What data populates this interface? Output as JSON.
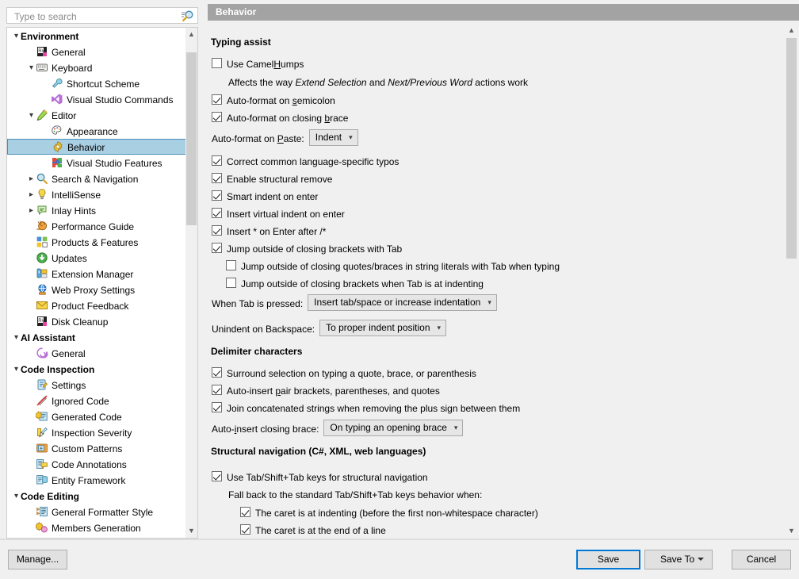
{
  "search": {
    "placeholder": "Type to search",
    "value": "",
    "icon": "search-icon"
  },
  "sidebar": {
    "items": [
      {
        "label": "Environment",
        "level": 0,
        "arrow": "expanded",
        "group": true,
        "icon": "none",
        "selected": false
      },
      {
        "label": "General",
        "level": 1,
        "arrow": "none",
        "group": false,
        "icon": "resharper-general-icon",
        "selected": false
      },
      {
        "label": "Keyboard",
        "level": 1,
        "arrow": "expanded",
        "group": false,
        "icon": "keyboard-icon",
        "selected": false
      },
      {
        "label": "Shortcut Scheme",
        "level": 2,
        "arrow": "none",
        "group": false,
        "icon": "wrench-icon",
        "selected": false
      },
      {
        "label": "Visual Studio Commands",
        "level": 2,
        "arrow": "none",
        "group": false,
        "icon": "visual-studio-icon",
        "selected": false
      },
      {
        "label": "Editor",
        "level": 1,
        "arrow": "expanded",
        "group": false,
        "icon": "pencil-icon",
        "selected": false
      },
      {
        "label": "Appearance",
        "level": 2,
        "arrow": "none",
        "group": false,
        "icon": "palette-icon",
        "selected": false
      },
      {
        "label": "Behavior",
        "level": 2,
        "arrow": "none",
        "group": false,
        "icon": "gear-icon",
        "selected": true
      },
      {
        "label": "Visual Studio Features",
        "level": 2,
        "arrow": "none",
        "group": false,
        "icon": "puzzle-icon",
        "selected": false
      },
      {
        "label": "Search & Navigation",
        "level": 1,
        "arrow": "collapsed",
        "group": false,
        "icon": "magnifier-icon",
        "selected": false
      },
      {
        "label": "IntelliSense",
        "level": 1,
        "arrow": "collapsed",
        "group": false,
        "icon": "lightbulb-icon",
        "selected": false
      },
      {
        "label": "Inlay Hints",
        "level": 1,
        "arrow": "collapsed",
        "group": false,
        "icon": "inlay-hints-icon",
        "selected": false
      },
      {
        "label": "Performance Guide",
        "level": 1,
        "arrow": "none",
        "group": false,
        "icon": "snail-icon",
        "selected": false
      },
      {
        "label": "Products & Features",
        "level": 1,
        "arrow": "none",
        "group": false,
        "icon": "products-icon",
        "selected": false
      },
      {
        "label": "Updates",
        "level": 1,
        "arrow": "none",
        "group": false,
        "icon": "updates-icon",
        "selected": false
      },
      {
        "label": "Extension Manager",
        "level": 1,
        "arrow": "none",
        "group": false,
        "icon": "extension-icon",
        "selected": false
      },
      {
        "label": "Web Proxy Settings",
        "level": 1,
        "arrow": "none",
        "group": false,
        "icon": "globe-icon",
        "selected": false
      },
      {
        "label": "Product Feedback",
        "level": 1,
        "arrow": "none",
        "group": false,
        "icon": "envelope-icon",
        "selected": false
      },
      {
        "label": "Disk Cleanup",
        "level": 1,
        "arrow": "none",
        "group": false,
        "icon": "resharper-general-icon",
        "selected": false
      },
      {
        "label": "AI Assistant",
        "level": 0,
        "arrow": "expanded",
        "group": true,
        "icon": "none",
        "selected": false
      },
      {
        "label": "General",
        "level": 1,
        "arrow": "none",
        "group": false,
        "icon": "ai-swirl-icon",
        "selected": false
      },
      {
        "label": "Code Inspection",
        "level": 0,
        "arrow": "expanded",
        "group": true,
        "icon": "none",
        "selected": false
      },
      {
        "label": "Settings",
        "level": 1,
        "arrow": "none",
        "group": false,
        "icon": "settings-icon",
        "selected": false
      },
      {
        "label": "Ignored Code",
        "level": 1,
        "arrow": "none",
        "group": false,
        "icon": "ignored-code-icon",
        "selected": false
      },
      {
        "label": "Generated Code",
        "level": 1,
        "arrow": "none",
        "group": false,
        "icon": "generated-code-icon",
        "selected": false
      },
      {
        "label": "Inspection Severity",
        "level": 1,
        "arrow": "none",
        "group": false,
        "icon": "inspection-severity-icon",
        "selected": false
      },
      {
        "label": "Custom Patterns",
        "level": 1,
        "arrow": "none",
        "group": false,
        "icon": "custom-patterns-icon",
        "selected": false
      },
      {
        "label": "Code Annotations",
        "level": 1,
        "arrow": "none",
        "group": false,
        "icon": "code-annotations-icon",
        "selected": false
      },
      {
        "label": "Entity Framework",
        "level": 1,
        "arrow": "none",
        "group": false,
        "icon": "database-icon",
        "selected": false
      },
      {
        "label": "Code Editing",
        "level": 0,
        "arrow": "expanded",
        "group": true,
        "icon": "none",
        "selected": false
      },
      {
        "label": "General Formatter Style",
        "level": 1,
        "arrow": "none",
        "group": false,
        "icon": "formatter-icon",
        "selected": false
      },
      {
        "label": "Members Generation",
        "level": 1,
        "arrow": "none",
        "group": false,
        "icon": "members-generation-icon",
        "selected": false
      }
    ]
  },
  "page": {
    "header": "Behavior",
    "sections": {
      "typing_assist": "Typing assist",
      "delimiter_characters": "Delimiter characters",
      "structural_navigation": "Structural navigation (C#, XML, web languages)"
    },
    "typing_assist": {
      "use_camel_humps": {
        "label_pre": "Use Camel",
        "label_accel": "H",
        "label_post": "umps",
        "checked": false
      },
      "camel_humps_note": {
        "a": "Affects the way ",
        "b": "Extend Selection",
        "c": " and ",
        "d": "Next/Previous Word",
        "e": " actions work"
      },
      "auto_format_semicolon": {
        "label_pre": "Auto-format on ",
        "label_accel": "s",
        "label_post": "emicolon",
        "checked": true
      },
      "auto_format_closing_brace": {
        "label_pre": "Auto-format on closing ",
        "label_accel": "b",
        "label_post": "race",
        "checked": true
      },
      "auto_format_paste": {
        "label_pre": "Auto-format on ",
        "label_accel": "P",
        "label_post": "aste:",
        "value": "Indent"
      },
      "correct_typos": {
        "label": "Correct common language-specific typos",
        "checked": true
      },
      "structural_remove": {
        "label": "Enable structural remove",
        "checked": true
      },
      "smart_indent": {
        "label": "Smart indent on enter",
        "checked": true
      },
      "virtual_indent": {
        "label": "Insert virtual indent on enter",
        "checked": true
      },
      "insert_star": {
        "label": "Insert * on Enter after /*",
        "checked": true
      },
      "jump_outside_brackets_tab": {
        "label": "Jump outside of closing brackets with Tab",
        "checked": true
      },
      "jump_outside_quotes": {
        "label": "Jump outside of closing quotes/braces in string literals with Tab when typing",
        "checked": false
      },
      "jump_outside_indenting": {
        "label": "Jump outside of closing brackets when Tab is at indenting",
        "checked": false
      },
      "when_tab_pressed": {
        "label": "When Tab is pressed:",
        "value": "Insert tab/space or increase indentation"
      },
      "unindent_backspace": {
        "label": "Unindent on Backspace:",
        "value": "To proper indent position"
      }
    },
    "delimiter_characters": {
      "surround_selection": {
        "label": "Surround selection on typing a quote, brace, or parenthesis",
        "checked": true
      },
      "auto_insert_pair": {
        "label_pre": "Auto-insert ",
        "label_accel": "p",
        "label_post": "air brackets, parentheses, and quotes",
        "checked": true
      },
      "join_concatenated": {
        "label": "Join concatenated strings when removing the plus sign between them",
        "checked": true
      },
      "auto_insert_closing_brace": {
        "label_pre": "Auto-",
        "label_accel": "i",
        "label_post": "nsert closing brace:",
        "value": "On typing an opening brace"
      }
    },
    "structural_navigation": {
      "use_tab_shift_tab": {
        "label": "Use Tab/Shift+Tab keys for structural navigation",
        "checked": true
      },
      "fallback_note": "Fall back to the standard Tab/Shift+Tab keys behavior when:",
      "caret_at_indenting": {
        "label": "The caret is at indenting (before the first non-whitespace character)",
        "checked": true
      },
      "caret_end_of_line": {
        "label": "The caret is at the end of a line",
        "checked": true
      }
    }
  },
  "footer": {
    "manage": "Manage...",
    "save": "Save",
    "save_to": "Save To",
    "cancel": "Cancel"
  },
  "colors": {
    "header_bg": "#a3a3a3",
    "selection_bg": "#a9cfe3",
    "selection_border": "#4a8fb5",
    "focus_border": "#0078d7",
    "window_bg": "#f0f0f0"
  }
}
